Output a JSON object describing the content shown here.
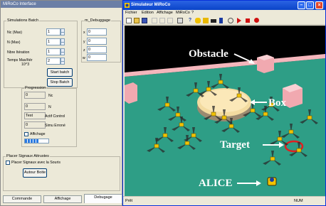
{
  "left_window": {
    "title": "MiRoCo Interface",
    "simulations_group": {
      "legend": "Simulations Batch",
      "nc_label": "Nc (Max)",
      "nc_value": "1",
      "n_label": "N (Max)",
      "n_value": "1",
      "iterations_label": "Nbre Itération",
      "iterations_value": "1",
      "time_label": "Temps Max/Itér",
      "time_value": "2",
      "time_exp": "10^3",
      "start_label": "Start batch",
      "stop_label": "Stop Batch"
    },
    "debug_group": {
      "legend": "m_Debuggage",
      "x_label": "x",
      "x_value": "0",
      "y_label": "y",
      "y_value": "0",
      "z_label": "z",
      "z_value": "0",
      "w_label": "w",
      "w_value": "0"
    },
    "progress_group": {
      "legend": "Progression",
      "nc_value": "0",
      "nc_label": "Nc",
      "n_value": "0",
      "n_label": "N",
      "test_value": "Test",
      "test_label": "Actif Control",
      "sim_value": "0",
      "sim_label": "Simu Erroné",
      "display_label": "Affichage",
      "progress": 0.6
    },
    "signals_group": {
      "legend": "Placer Signaux Attrustes",
      "mouse_label": "Placer Signaux avec la Souris",
      "auto_label": "Autour Boite"
    },
    "tabs": [
      "Commande",
      "Affichage",
      "Debugage"
    ]
  },
  "right_window": {
    "title": "Simulateur MiRoCo",
    "menu": [
      "Fichier",
      "Edition",
      "Affichage",
      "MiRoCo",
      "?"
    ],
    "status_left": "Prêt",
    "status_right": "NUM",
    "scene": {
      "labels": {
        "obstacle": "Obstacle",
        "box": "Box",
        "target": "Target",
        "alice": "ALICE"
      },
      "colors": {
        "floor": "#2e9e86",
        "background": "#000000",
        "wall": "#f0a0a8",
        "box": "#f5dca0",
        "target": "#e02020",
        "robot": "#f2c200"
      }
    }
  }
}
